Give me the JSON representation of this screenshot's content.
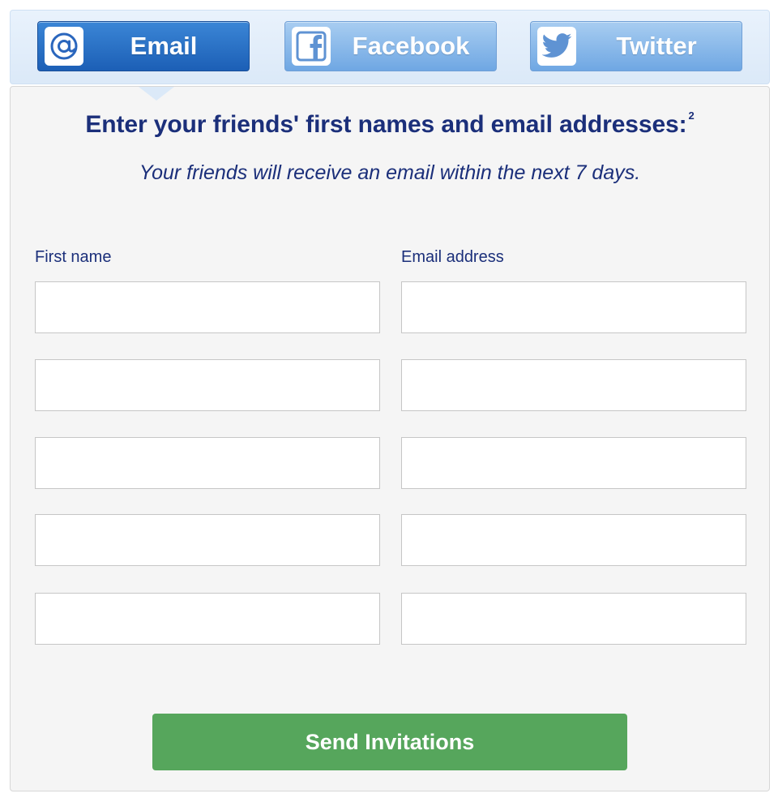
{
  "tabs": [
    {
      "label": "Email",
      "icon": "at-sign-icon",
      "active": true
    },
    {
      "label": "Facebook",
      "icon": "facebook-icon",
      "active": false
    },
    {
      "label": "Twitter",
      "icon": "twitter-bird-icon",
      "active": false
    }
  ],
  "form": {
    "heading": "Enter your friends' first names and email addresses:",
    "footnote": "2",
    "subheading": "Your friends will receive an email within the next 7 days.",
    "first_name_label": "First name",
    "email_label": "Email address",
    "rows": [
      {
        "first_name": "",
        "email": ""
      },
      {
        "first_name": "",
        "email": ""
      },
      {
        "first_name": "",
        "email": ""
      },
      {
        "first_name": "",
        "email": ""
      },
      {
        "first_name": "",
        "email": ""
      }
    ],
    "submit_label": "Send Invitations"
  },
  "colors": {
    "heading_text": "#1b2f7a",
    "active_tab": "#1c5fb6",
    "inactive_tab": "#6fa7e3",
    "submit_button": "#56a65c",
    "panel_background": "#f5f5f5"
  }
}
